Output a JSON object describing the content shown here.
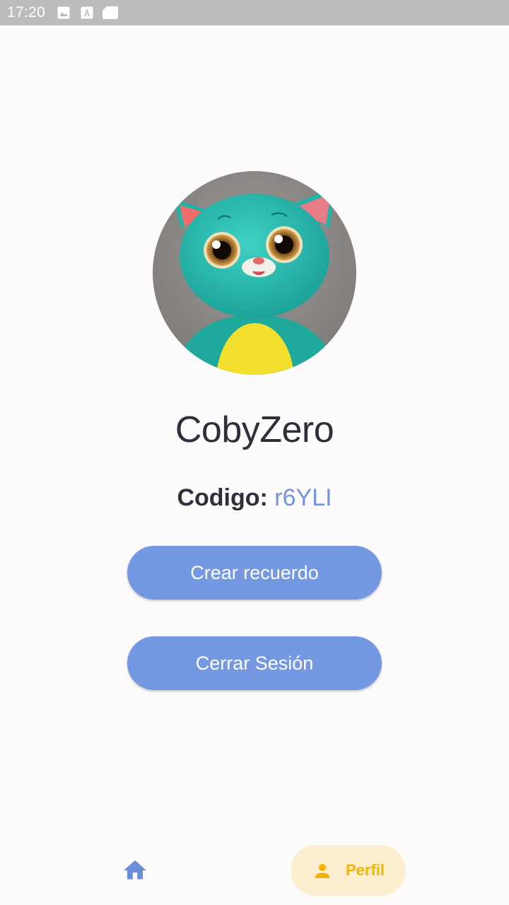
{
  "status_bar": {
    "time": "17:20",
    "icons": [
      "image-icon",
      "font-download-icon",
      "sd-card-icon"
    ]
  },
  "profile": {
    "avatar": "cat-avatar",
    "username": "CobyZero",
    "code_label": "Codigo:",
    "code_value": "r6YLI"
  },
  "actions": {
    "create_memory": "Crear recuerdo",
    "logout": "Cerrar Sesión"
  },
  "bottom_nav": {
    "home_icon": "home-icon",
    "profile_icon": "person-icon",
    "profile_label": "Perfil",
    "active_tab": "Perfil"
  },
  "colors": {
    "accent_blue": "#7598e3",
    "code_blue": "#7392e0",
    "active_nav_bg": "#fdeecf",
    "active_nav_fg": "#f3b400",
    "status_bar": "#bdbbbc",
    "text_dark": "#2f2e3a",
    "background": "#fefbfd"
  }
}
